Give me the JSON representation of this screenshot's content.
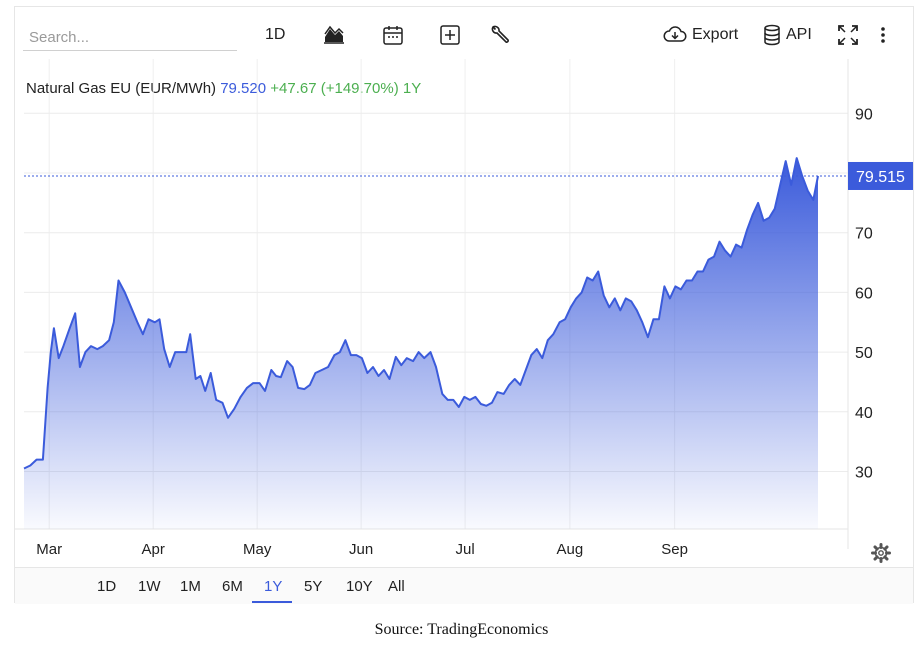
{
  "toolbar": {
    "search_placeholder": "Search...",
    "interval_label": "1D",
    "export_label": "Export",
    "api_label": "API",
    "icons": [
      "chart-type-icon",
      "calendar-icon",
      "add-indicator-icon",
      "wrench-icon",
      "cloud-download-icon",
      "database-icon",
      "fullscreen-icon",
      "more-vertical-icon"
    ]
  },
  "header": {
    "name": "Natural Gas EU (EUR/MWh)",
    "price": "79.520",
    "change": "+47.67 (+149.70%)",
    "period": "1Y"
  },
  "range_buttons": [
    "1D",
    "1W",
    "1M",
    "6M",
    "1Y",
    "5Y",
    "10Y",
    "All"
  ],
  "active_range": "1Y",
  "source": "Source: TradingEconomics",
  "colors": {
    "line": "#3b5bdb",
    "fill_top": "#3b5bdb",
    "tag_bg": "#3b5bdb",
    "change": "#4caf50"
  },
  "chart_data": {
    "type": "area",
    "title": "Natural Gas EU (EUR/MWh)",
    "last_value_tag": "79.515",
    "y_ticks": [
      30,
      40,
      50,
      60,
      70,
      90
    ],
    "ylim": [
      21,
      92
    ],
    "x_ticks": [
      {
        "label": "Mar",
        "t": 3.2
      },
      {
        "label": "Apr",
        "t": 16.4
      },
      {
        "label": "May",
        "t": 29.6
      },
      {
        "label": "Jun",
        "t": 42.8
      },
      {
        "label": "Jul",
        "t": 56.0
      },
      {
        "label": "Aug",
        "t": 69.3
      },
      {
        "label": "Sep",
        "t": 82.6
      }
    ],
    "xlim": [
      0,
      93
    ],
    "grid": true,
    "points": [
      [
        0,
        30.5
      ],
      [
        0.8,
        31
      ],
      [
        1.6,
        32
      ],
      [
        2.4,
        32
      ],
      [
        3.0,
        44
      ],
      [
        3.4,
        50
      ],
      [
        3.8,
        54
      ],
      [
        4.4,
        49
      ],
      [
        5.0,
        51
      ],
      [
        5.8,
        54
      ],
      [
        6.5,
        56.5
      ],
      [
        7.1,
        47.5
      ],
      [
        7.8,
        50
      ],
      [
        8.5,
        51
      ],
      [
        9.3,
        50.5
      ],
      [
        10.0,
        51
      ],
      [
        10.8,
        52
      ],
      [
        11.4,
        55
      ],
      [
        12.0,
        62
      ],
      [
        12.8,
        60
      ],
      [
        13.6,
        57.5
      ],
      [
        14.4,
        55
      ],
      [
        15.1,
        53
      ],
      [
        15.8,
        55.5
      ],
      [
        16.6,
        55
      ],
      [
        17.2,
        55.5
      ],
      [
        17.8,
        50.5
      ],
      [
        18.5,
        47.5
      ],
      [
        19.2,
        50
      ],
      [
        20.0,
        50
      ],
      [
        20.6,
        50
      ],
      [
        21.1,
        53
      ],
      [
        21.8,
        45.5
      ],
      [
        22.4,
        46
      ],
      [
        23.0,
        43.5
      ],
      [
        23.7,
        46.5
      ],
      [
        24.4,
        42
      ],
      [
        25.2,
        41.5
      ],
      [
        25.9,
        39
      ],
      [
        26.7,
        40.5
      ],
      [
        27.5,
        42.5
      ],
      [
        28.3,
        44
      ],
      [
        29.1,
        44.8
      ],
      [
        29.9,
        44.8
      ],
      [
        30.6,
        43.5
      ],
      [
        31.4,
        47
      ],
      [
        32.0,
        46
      ],
      [
        32.6,
        45.8
      ],
      [
        33.4,
        48.5
      ],
      [
        34.1,
        47.5
      ],
      [
        34.8,
        44
      ],
      [
        35.6,
        43.8
      ],
      [
        36.3,
        44.5
      ],
      [
        37.0,
        46.5
      ],
      [
        37.8,
        47
      ],
      [
        38.6,
        47.5
      ],
      [
        39.4,
        49.5
      ],
      [
        40.1,
        50
      ],
      [
        40.8,
        52
      ],
      [
        41.5,
        49.5
      ],
      [
        42.2,
        49.5
      ],
      [
        42.9,
        49
      ],
      [
        43.6,
        46.5
      ],
      [
        44.3,
        47.5
      ],
      [
        45.0,
        46
      ],
      [
        45.7,
        47
      ],
      [
        46.4,
        45.5
      ],
      [
        47.2,
        49.2
      ],
      [
        47.9,
        47.8
      ],
      [
        48.6,
        49
      ],
      [
        49.4,
        48.5
      ],
      [
        50.1,
        50
      ],
      [
        50.8,
        49
      ],
      [
        51.6,
        50
      ],
      [
        52.3,
        47.5
      ],
      [
        53.1,
        43
      ],
      [
        53.8,
        42
      ],
      [
        54.5,
        42
      ],
      [
        55.2,
        40.8
      ],
      [
        55.9,
        42.5
      ],
      [
        56.6,
        42
      ],
      [
        57.3,
        42.5
      ],
      [
        58.0,
        41.3
      ],
      [
        58.7,
        41
      ],
      [
        59.4,
        41.5
      ],
      [
        60.1,
        43.3
      ],
      [
        60.9,
        43
      ],
      [
        61.6,
        44.5
      ],
      [
        62.3,
        45.5
      ],
      [
        63.0,
        44.5
      ],
      [
        63.7,
        47
      ],
      [
        64.4,
        49.5
      ],
      [
        65.1,
        50.5
      ],
      [
        65.8,
        49
      ],
      [
        66.5,
        52
      ],
      [
        67.2,
        53
      ],
      [
        68.0,
        55
      ],
      [
        68.7,
        55.5
      ],
      [
        69.4,
        57.5
      ],
      [
        70.1,
        59
      ],
      [
        70.8,
        60
      ],
      [
        71.5,
        62.5
      ],
      [
        72.2,
        62
      ],
      [
        72.9,
        63.5
      ],
      [
        73.6,
        59.5
      ],
      [
        74.3,
        57.5
      ],
      [
        75.0,
        59
      ],
      [
        75.7,
        57
      ],
      [
        76.4,
        59
      ],
      [
        77.1,
        58.5
      ],
      [
        77.8,
        57
      ],
      [
        78.5,
        55
      ],
      [
        79.2,
        52.5
      ],
      [
        79.9,
        55.5
      ],
      [
        80.6,
        55.5
      ],
      [
        81.3,
        61
      ],
      [
        82.0,
        59
      ],
      [
        82.7,
        61
      ],
      [
        83.4,
        60.5
      ],
      [
        84.1,
        62
      ],
      [
        84.8,
        62
      ],
      [
        85.5,
        63.5
      ],
      [
        86.2,
        63.5
      ],
      [
        86.9,
        65.5
      ],
      [
        87.6,
        66
      ],
      [
        88.3,
        68.5
      ],
      [
        89.0,
        67
      ],
      [
        89.7,
        66
      ],
      [
        90.4,
        68
      ],
      [
        91.1,
        67.5
      ],
      [
        91.8,
        70.5
      ],
      [
        92.5,
        73
      ],
      [
        93.2,
        75
      ],
      [
        93.9,
        72
      ],
      [
        94.6,
        72.5
      ],
      [
        95.3,
        74
      ],
      [
        96.0,
        78
      ],
      [
        96.7,
        82
      ],
      [
        97.4,
        78
      ],
      [
        98.1,
        82.5
      ],
      [
        98.8,
        79.5
      ],
      [
        99.5,
        77
      ],
      [
        100.2,
        75.5
      ],
      [
        100.8,
        79.5
      ]
    ]
  }
}
